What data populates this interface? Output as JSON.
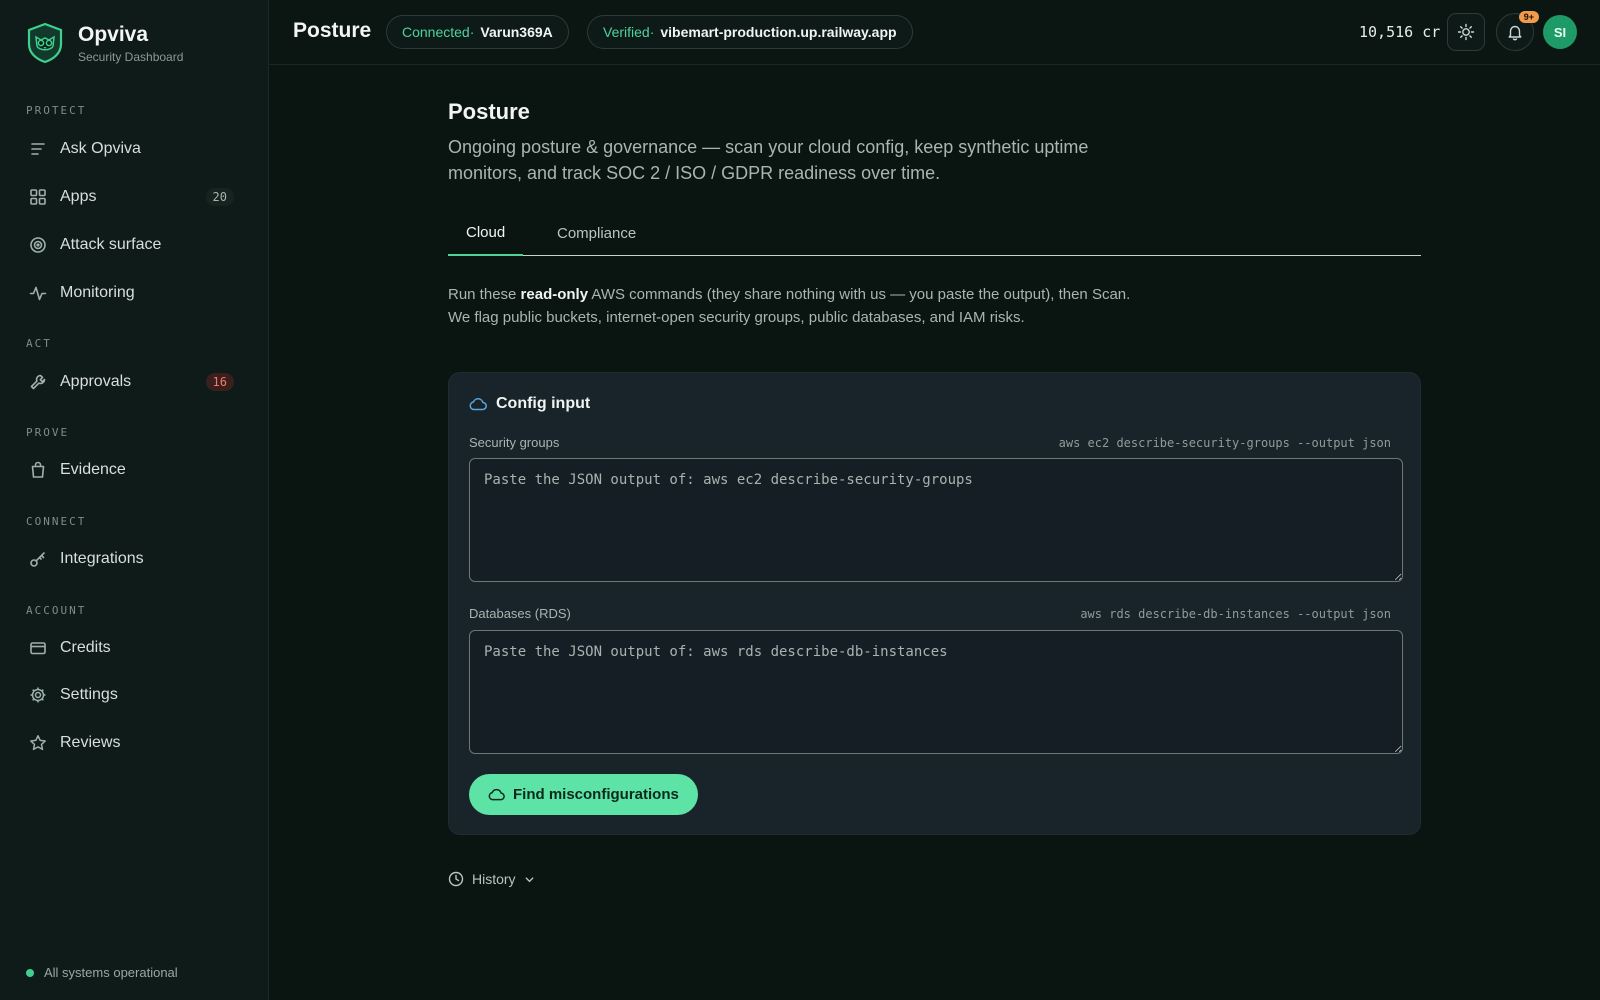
{
  "brand": {
    "name": "Opviva",
    "subtitle": "Security Dashboard"
  },
  "sidebar": {
    "sections": [
      "PROTECT",
      "ACT",
      "PROVE",
      "CONNECT",
      "ACCOUNT"
    ],
    "items": [
      {
        "label": "Ask Opviva",
        "icon": "list-icon"
      },
      {
        "label": "Apps",
        "icon": "grid-icon",
        "badge": "20"
      },
      {
        "label": "Attack surface",
        "icon": "target-icon"
      },
      {
        "label": "Monitoring",
        "icon": "pulse-icon"
      },
      {
        "label": "Approvals",
        "icon": "wrench-icon",
        "badge": "16"
      },
      {
        "label": "Evidence",
        "icon": "bag-icon"
      },
      {
        "label": "Integrations",
        "icon": "key-icon"
      },
      {
        "label": "Credits",
        "icon": "card-icon"
      },
      {
        "label": "Settings",
        "icon": "gear-icon"
      },
      {
        "label": "Reviews",
        "icon": "star-icon"
      }
    ],
    "status": "All systems operational"
  },
  "topbar": {
    "title": "Posture",
    "connected_label": "Connected·",
    "connected_value": "Varun369A",
    "verified_label": "Verified·",
    "verified_value": "vibemart-production.up.railway.app",
    "credits": "10,516 cr",
    "notifications": "9+",
    "avatar_initials": "SI"
  },
  "main": {
    "title": "Posture",
    "description": "Ongoing posture & governance — scan your cloud config, keep synthetic uptime monitors, and track SOC 2 / ISO / GDPR readiness over time.",
    "tabs": [
      {
        "label": "Cloud",
        "active": true
      },
      {
        "label": "Compliance",
        "active": false
      }
    ],
    "intro_prefix": "Run these ",
    "intro_bold": "read-only",
    "intro_suffix": " AWS commands (they share nothing with us — you paste the output), then Scan. We flag public buckets, internet-open security groups, public databases, and IAM risks.",
    "card": {
      "title": "Config input",
      "fields": [
        {
          "label": "Security groups",
          "command": "aws ec2 describe-security-groups --output json",
          "value": "",
          "placeholder": "Paste the JSON output of: aws ec2 describe-security-groups"
        },
        {
          "label": "Databases (RDS)",
          "command": "aws rds describe-db-instances --output json",
          "value": "",
          "placeholder": "Paste the JSON output of: aws rds describe-db-instances"
        }
      ],
      "button": "Find misconfigurations"
    },
    "history_label": "History"
  },
  "colors": {
    "accent": "#5ee3a6",
    "danger": "#f27a6c",
    "background": "#0a1512",
    "sidebar": "#0f1b18",
    "card": "#18232a"
  }
}
